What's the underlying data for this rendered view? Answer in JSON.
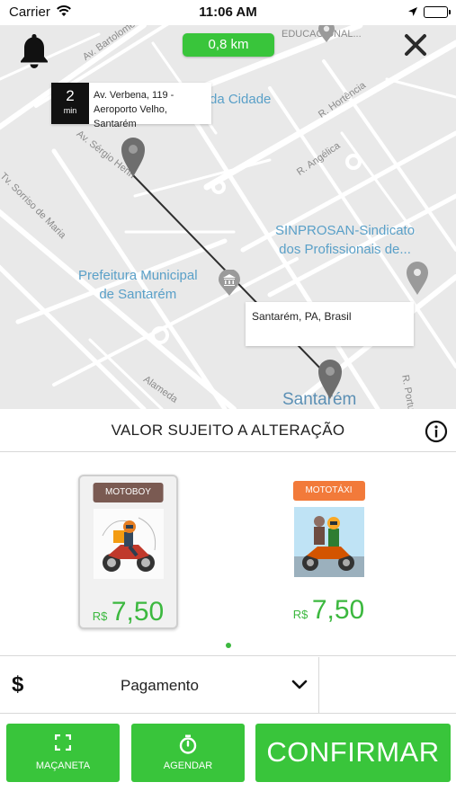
{
  "status_bar": {
    "carrier": "Carrier",
    "time": "11:06 AM"
  },
  "map": {
    "distance": "0,8 km",
    "eta": {
      "value": "2",
      "unit": "min"
    },
    "origin_address_line1": "Av. Verbena, 119 -",
    "origin_address_line2": "Aeroporto Velho, Santarém",
    "destination_address": "Santarém, PA, Brasil",
    "street_labels": [
      "Av. Bartolomeu",
      "Av. Sérgio Henn",
      "Tv. Sorriso de Maria",
      "R. Hortência",
      "R. Angélica",
      "Alameda",
      "R. Portu",
      "EDUCACIONAL..."
    ],
    "pois": {
      "cidade": "da Cidade",
      "sinprosan_line1": "SINPROSAN-Sindicato",
      "sinprosan_line2": "dos Profissionais de...",
      "prefeitura_line1": "Prefeitura Municipal",
      "prefeitura_line2": "de Santarém",
      "city": "Santarém"
    }
  },
  "notice": {
    "text": "VALOR SUJEITO A ALTERAÇÃO"
  },
  "vehicles": [
    {
      "type": "MOTOBOY",
      "currency": "R$",
      "price": "7,50",
      "badge_color": "#7a5a52",
      "selected": true
    },
    {
      "type": "MOTOTÁXI",
      "currency": "R$",
      "price": "7,50",
      "badge_color": "#f27a3a",
      "selected": false
    }
  ],
  "payment": {
    "label": "Pagamento",
    "currency_symbol": "$"
  },
  "actions": {
    "macaneta": "MAÇANETA",
    "agendar": "AGENDAR",
    "confirmar": "CONFIRMAR"
  },
  "colors": {
    "accent": "#39c53b",
    "price": "#3cb83f"
  }
}
